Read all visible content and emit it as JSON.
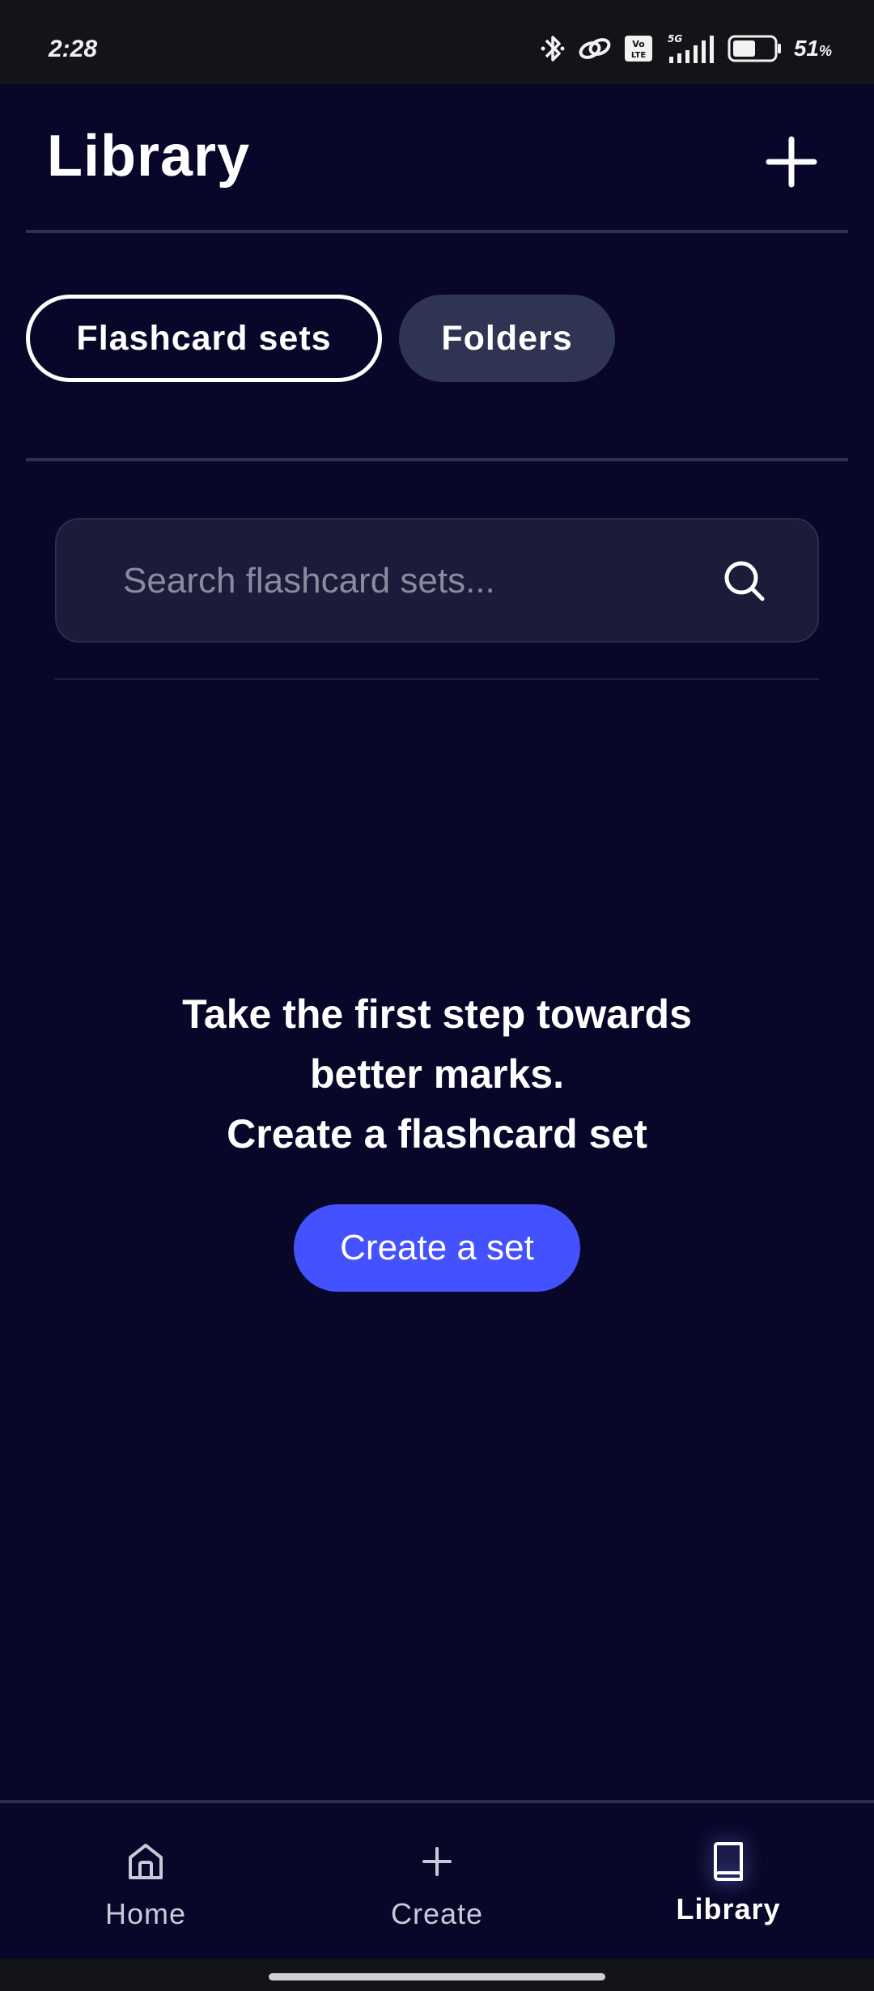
{
  "status_bar": {
    "time": "2:28",
    "battery_percent": "51",
    "battery_unit": "%",
    "network": "5G",
    "icons": [
      "bluetooth-icon",
      "link-icon",
      "volte-icon",
      "signal-icon",
      "battery-icon"
    ]
  },
  "header": {
    "title": "Library",
    "add_icon": "plus-icon"
  },
  "tabs": [
    {
      "label": "Flashcard sets",
      "active": true
    },
    {
      "label": "Folders",
      "active": false
    }
  ],
  "search": {
    "placeholder": "Search flashcard sets...",
    "value": "",
    "icon": "search-icon"
  },
  "empty_state": {
    "line1": "Take the first step towards",
    "line2": "better marks.",
    "line3": "Create a flashcard set",
    "button_label": "Create a set"
  },
  "bottom_nav": {
    "items": [
      {
        "label": "Home",
        "icon": "home-icon",
        "active": false
      },
      {
        "label": "Create",
        "icon": "plus-icon",
        "active": false
      },
      {
        "label": "Library",
        "icon": "book-icon",
        "active": true
      }
    ]
  },
  "colors": {
    "background": "#080729",
    "accent": "#4451ff",
    "inactive_tab": "#2e3452",
    "search_bg": "#1b1b3a"
  }
}
